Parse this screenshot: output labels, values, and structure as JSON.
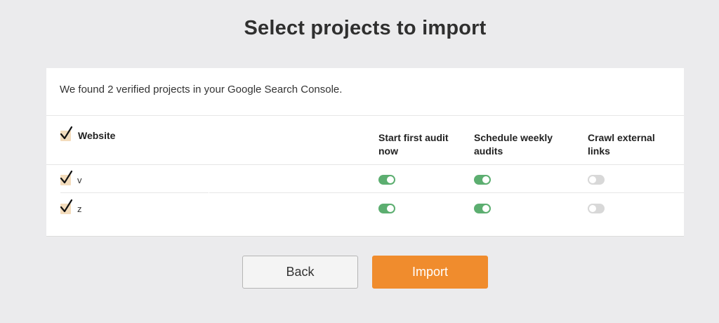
{
  "page": {
    "title": "Select projects to import"
  },
  "card": {
    "intro": "We found 2 verified projects in your Google Search Console."
  },
  "table": {
    "columns": {
      "website": "Website",
      "start_audit": "Start first audit now",
      "schedule_weekly": "Schedule weekly audits",
      "crawl_external": "Crawl external links"
    },
    "select_all_checked": true,
    "rows": [
      {
        "website": "v",
        "checked": true,
        "start_audit": true,
        "schedule_weekly": true,
        "crawl_external": false
      },
      {
        "website": "z",
        "checked": true,
        "start_audit": true,
        "schedule_weekly": true,
        "crawl_external": false
      }
    ]
  },
  "buttons": {
    "back": "Back",
    "import": "Import"
  },
  "colors": {
    "accent": "#f08c2d",
    "toggle_on": "#5cae70",
    "toggle_off": "#d8d8d8",
    "checkbox_fill": "#f3dcbc"
  },
  "icons": {
    "checkbox": "checkmark-icon",
    "toggle": "toggle-switch"
  }
}
